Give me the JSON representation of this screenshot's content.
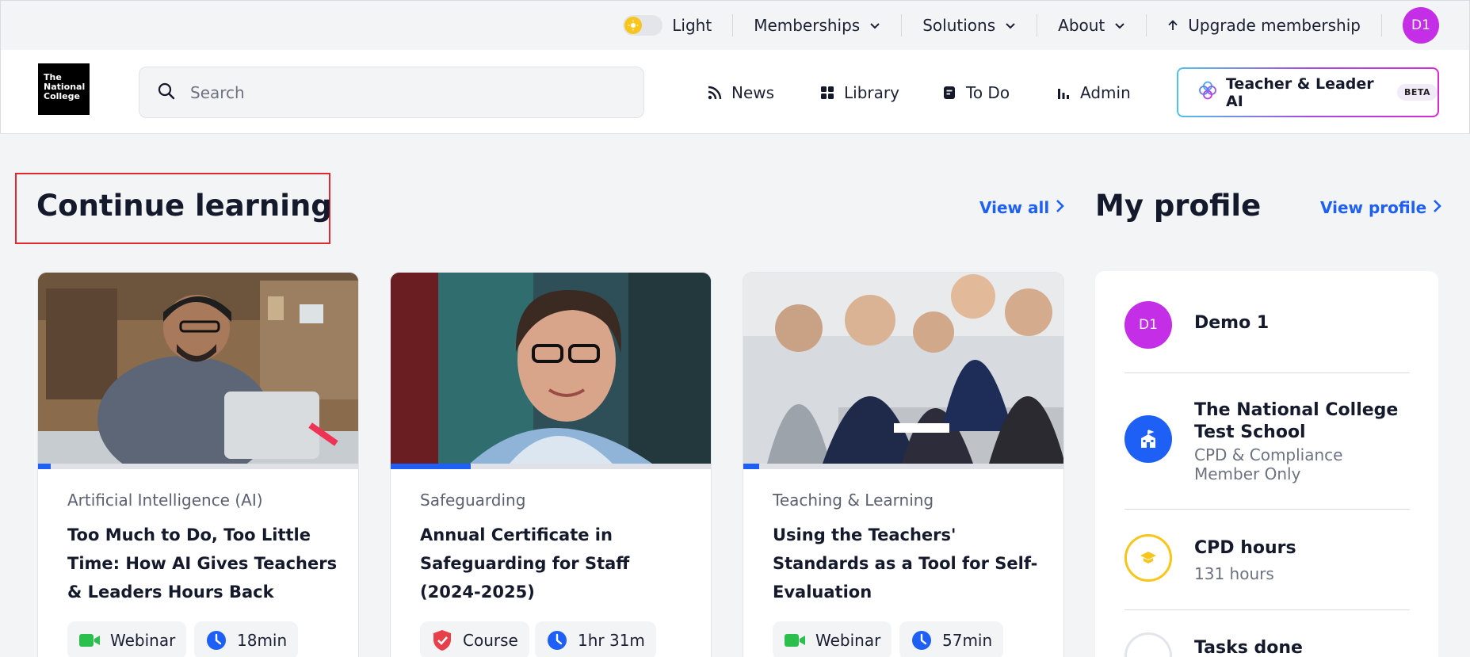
{
  "topbar": {
    "theme_label": "Light",
    "memberships": "Memberships",
    "solutions": "Solutions",
    "about": "About",
    "upgrade": "Upgrade membership",
    "avatar_initials": "D1"
  },
  "header": {
    "logo_lines": [
      "The",
      "National",
      "College"
    ],
    "search_placeholder": "Search",
    "nav": {
      "news": "News",
      "library": "Library",
      "todo": "To Do",
      "admin": "Admin"
    },
    "ai_button": "Teacher & Leader AI",
    "ai_badge": "BETA"
  },
  "continue_learning": {
    "title": "Continue learning",
    "view_all": "View all",
    "cards": [
      {
        "category": "Artificial Intelligence (AI)",
        "title": "Too Much to Do, Too Little Time: How AI Gives Teachers & Leaders Hours Back",
        "type": "Webinar",
        "duration": "18min",
        "progress": 0.04
      },
      {
        "category": "Safeguarding",
        "title": "Annual Certificate in Safeguarding for Staff (2024-2025)",
        "type": "Course",
        "duration": "1hr 31m",
        "progress": 0.25
      },
      {
        "category": "Teaching & Learning",
        "title": "Using the Teachers' Standards as a Tool for Self-Evaluation",
        "type": "Webinar",
        "duration": "57min",
        "progress": 0.05
      }
    ]
  },
  "profile": {
    "title": "My profile",
    "view_profile": "View profile",
    "avatar_initials": "D1",
    "user_name": "Demo 1",
    "school_name": "The National College Test School",
    "school_membership": "CPD & Compliance Member Only",
    "cpd_label": "CPD hours",
    "cpd_value": "131 hours",
    "tasks_label": "Tasks done"
  },
  "colors": {
    "accent": "#1e5ff5",
    "avatar": "#c32ee6",
    "cpd_ring": "#f7c51c",
    "highlight": "#e0282e"
  }
}
